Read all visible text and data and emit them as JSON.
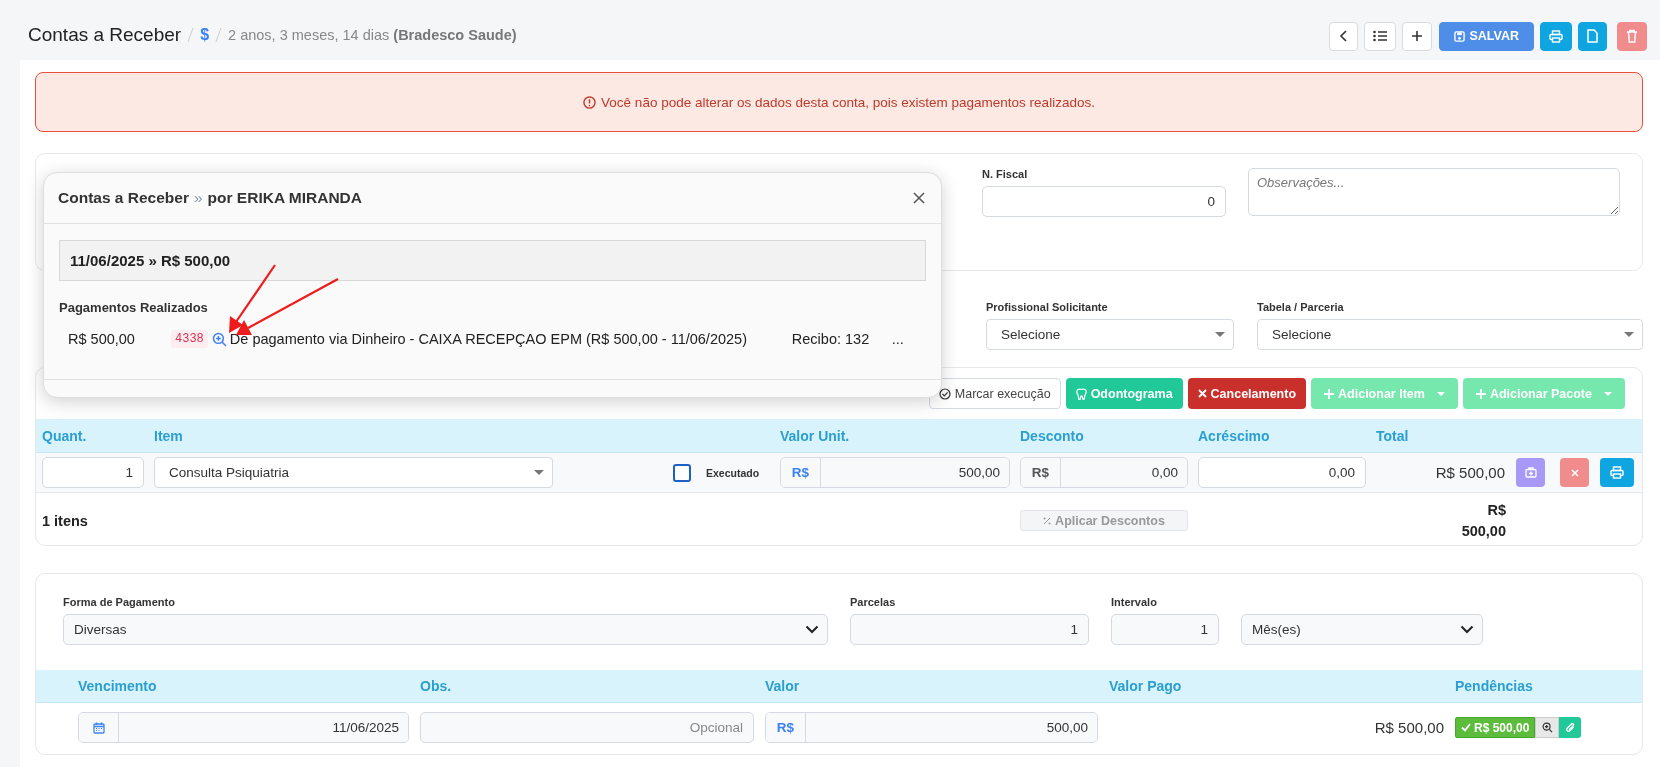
{
  "header": {
    "title": "Contas a Receber",
    "currency_symbol": "$",
    "subtitle": "2 anos, 3 meses, 14 dias **(Bradesco Saude)**",
    "toolbar": [
      {
        "kind": "back"
      },
      {
        "kind": "list"
      },
      {
        "kind": "add"
      },
      {
        "kind": "save",
        "label": "SALVAR"
      },
      {
        "kind": "print"
      },
      {
        "kind": "file"
      },
      {
        "kind": "delete"
      }
    ]
  },
  "alert": {
    "text": "Você não pode alterar os dados desta conta, pois existem pagamentos realizados."
  },
  "details": {
    "n_fiscal": {
      "label": "N. Fiscal",
      "value": "0"
    },
    "notes": {
      "placeholder": "Observações..."
    }
  },
  "filters": [
    {
      "label": "Profissional Solicitante",
      "value": "Selecione"
    },
    {
      "label": "Tabela / Parceria",
      "value": "Selecione"
    }
  ],
  "items": {
    "actions": [
      {
        "kind": "outline",
        "label": "Marcar execução"
      },
      {
        "kind": "teal",
        "label": "Odontograma"
      },
      {
        "kind": "danger",
        "label": "Cancelamento"
      },
      {
        "kind": "dropdown",
        "label": "Adicionar Item"
      },
      {
        "kind": "dropdown",
        "label": "Adicionar Pacote"
      }
    ],
    "columns": [
      "Quant.",
      "Item",
      "Valor Unit.",
      "Desconto",
      "Acréscimo",
      "Total"
    ],
    "rows": [
      {
        "quantity": "1",
        "item": "Consulta Psiquiatria",
        "executed": false,
        "executed_label": "Executado",
        "currency": "R$",
        "unit_value": "500,00",
        "discount_currency": "R$",
        "discount": "0,00",
        "surcharge": "0,00",
        "total": "R$ 500,00"
      }
    ],
    "count": "1 itens",
    "apply_discounts": "Aplicar Descontos",
    "grand_total": "R$ 500,00"
  },
  "payment": {
    "method": {
      "label": "Forma de Pagamento",
      "value": "Diversas"
    },
    "installments": {
      "label": "Parcelas",
      "value": "1"
    },
    "interval": {
      "label": "Intervalo",
      "value": "1"
    },
    "interval_unit": "Mês(es)",
    "columns": [
      "Vencimento",
      "Obs.",
      "Valor",
      "Valor Pago",
      "Pendências"
    ],
    "rows": [
      {
        "due_date": "11/06/2025",
        "obs_placeholder": "Opcional",
        "currency": "R$",
        "value": "500,00",
        "paid": "R$ 500,00",
        "pending": "R$ 500,00"
      }
    ]
  },
  "modal": {
    "title": "Contas a Receber",
    "separator": "»",
    "author": "por ERIKA MIRANDA",
    "summary": "11/06/2025 » R$ 500,00",
    "section": "Pagamentos Realizados",
    "payments": [
      {
        "amount": "R$ 500,00",
        "code": "4338",
        "description": "De pagamento via Dinheiro - CAIXA RECEPÇAO EPM (R$ 500,00 - 11/06/2025)",
        "receipt": "Recibo: 132",
        "more": "..."
      }
    ]
  }
}
